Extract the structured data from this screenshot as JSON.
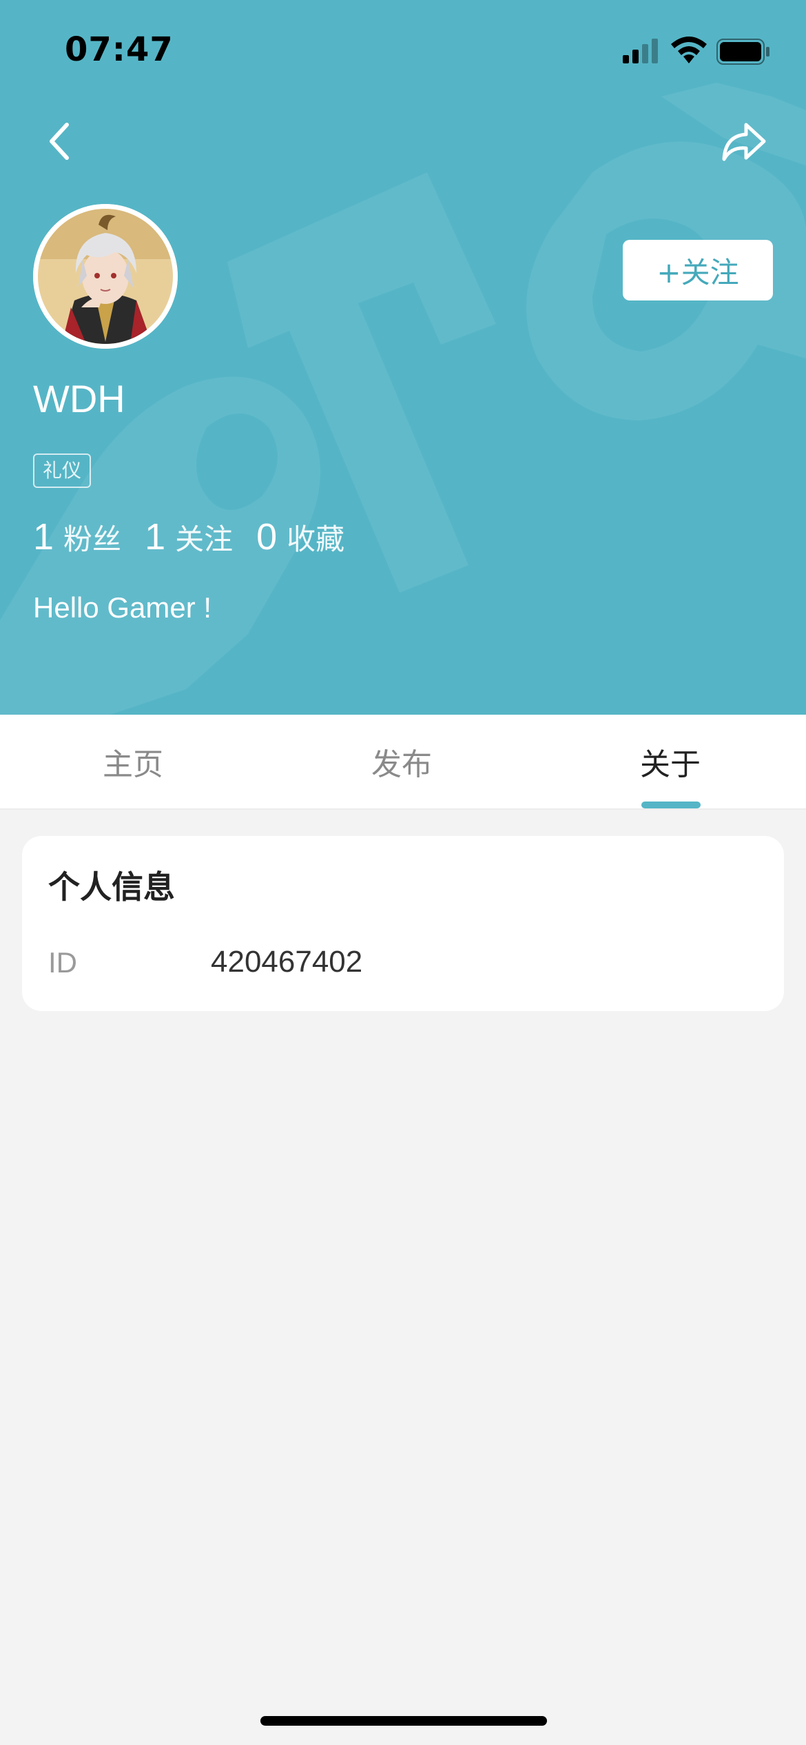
{
  "status_bar": {
    "time": "07:47",
    "icons": [
      "signal-icon",
      "wifi-icon",
      "battery-icon"
    ]
  },
  "nav": {
    "back_icon": "chevron-left-icon",
    "share_icon": "share-arrow-icon"
  },
  "profile": {
    "username": "WDH",
    "tag": "礼仪",
    "follow_button": "+关注",
    "bio": "Hello Gamer !",
    "stats": [
      {
        "value": "1",
        "label": "粉丝"
      },
      {
        "value": "1",
        "label": "关注"
      },
      {
        "value": "0",
        "label": "收藏"
      }
    ]
  },
  "tabs": [
    {
      "label": "主页",
      "active": false
    },
    {
      "label": "发布",
      "active": false
    },
    {
      "label": "关于",
      "active": true
    }
  ],
  "info_card": {
    "title": "个人信息",
    "fields": [
      {
        "label": "ID",
        "value": "420467402"
      }
    ]
  },
  "colors": {
    "header_bg": "#55b5c6",
    "accent": "#45a9bb",
    "page_bg": "#f3f3f3"
  }
}
